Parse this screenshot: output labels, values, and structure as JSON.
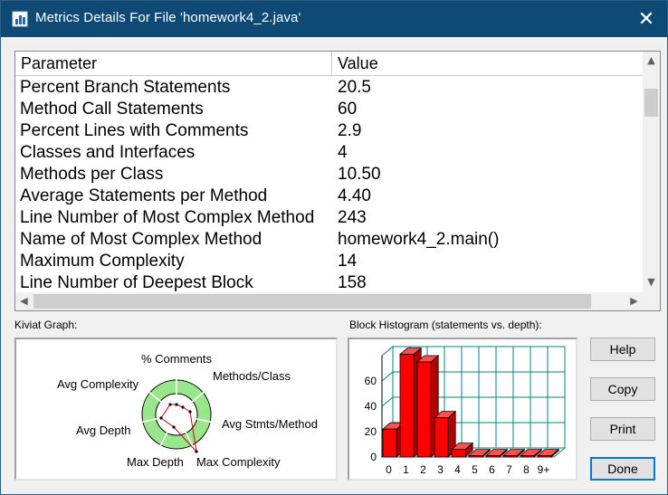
{
  "window": {
    "title": "Metrics Details For File 'homework4_2.java'",
    "close_glyph": "✕"
  },
  "table": {
    "columns": [
      "Parameter",
      "Value"
    ],
    "rows": [
      {
        "param": "Percent Branch Statements",
        "value": "20.5"
      },
      {
        "param": "Method Call Statements",
        "value": "60"
      },
      {
        "param": "Percent Lines with Comments",
        "value": "2.9"
      },
      {
        "param": "Classes and Interfaces",
        "value": "4"
      },
      {
        "param": "Methods per Class",
        "value": "10.50"
      },
      {
        "param": "Average Statements per Method",
        "value": "4.40"
      },
      {
        "param": "Line Number of Most Complex Method",
        "value": "243"
      },
      {
        "param": "Name of Most Complex Method",
        "value": "homework4_2.main()"
      },
      {
        "param": "Maximum Complexity",
        "value": "14"
      },
      {
        "param": "Line Number of Deepest Block",
        "value": "158"
      }
    ]
  },
  "kiviat": {
    "label": "Kiviat Graph:",
    "axes": {
      "comments": "% Comments",
      "methods": "Methods/Class",
      "stmts": "Avg Stmts/Method",
      "maxcomplexity": "Max Complexity",
      "maxdepth": "Max Depth",
      "avgdepth": "Avg Depth",
      "avgcomplexity": "Avg Complexity"
    }
  },
  "histogram": {
    "label": "Block Histogram (statements vs. depth):"
  },
  "chart_data": {
    "type": "bar",
    "categories": [
      "0",
      "1",
      "2",
      "3",
      "4",
      "5",
      "6",
      "7",
      "8",
      "9+"
    ],
    "values": [
      22,
      81,
      75,
      31,
      6,
      1,
      1,
      1,
      1,
      1
    ],
    "ylim": [
      0,
      80
    ],
    "yticks": [
      0,
      20,
      40,
      60
    ],
    "bar_color": "#ff0000",
    "grid_color": "#008080",
    "grid": true
  },
  "buttons": {
    "help": "Help",
    "copy": "Copy",
    "print": "Print",
    "done": "Done"
  },
  "colors": {
    "titlebar": "#0f4a75",
    "kiviat_ring": "#99e68c",
    "accent": "#0078d7"
  }
}
